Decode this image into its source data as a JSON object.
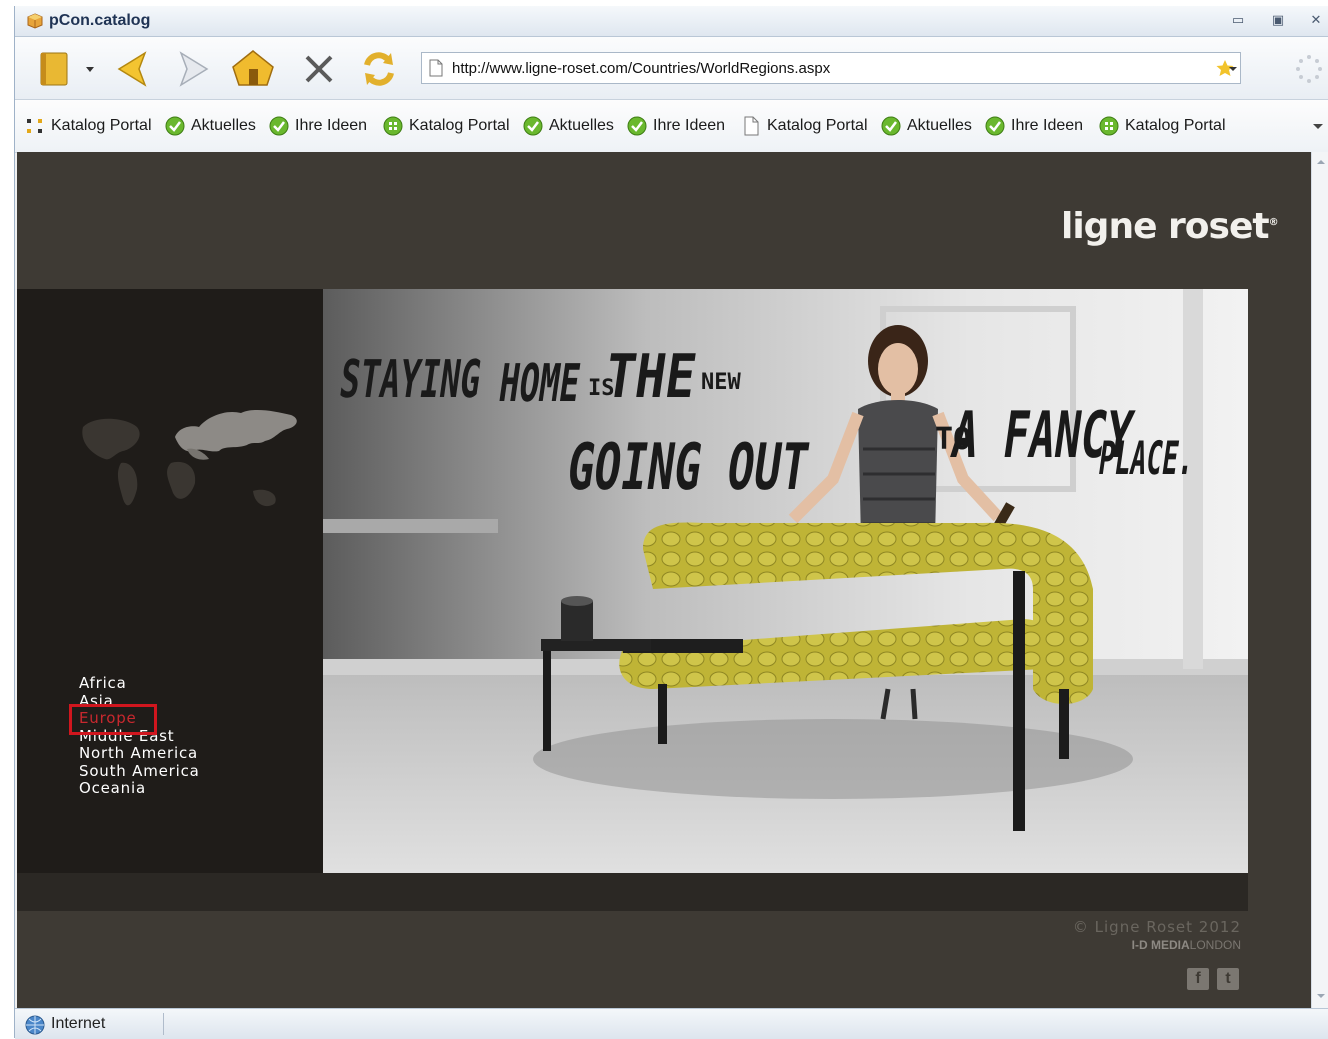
{
  "window": {
    "title": "pCon.catalog",
    "controls": [
      "minimize",
      "restore",
      "close"
    ]
  },
  "toolbar": {
    "url": "http://www.ligne-roset.com/Countries/WorldRegions.aspx",
    "buttons": [
      "catalog-book-icon",
      "dropdown-arrow-icon",
      "back-icon",
      "forward-icon",
      "home-icon",
      "stop-icon",
      "refresh-icon"
    ]
  },
  "favorites": [
    {
      "label": "Katalog Portal",
      "icon": "portal-dots-icon"
    },
    {
      "label": "Aktuelles",
      "icon": "green-check-icon"
    },
    {
      "label": "Ihre Ideen",
      "icon": "green-check-icon"
    },
    {
      "label": "Katalog Portal",
      "icon": "green-grid-icon"
    },
    {
      "label": "Aktuelles",
      "icon": "green-check-icon"
    },
    {
      "label": "Ihre Ideen",
      "icon": "green-check-icon"
    },
    {
      "label": "Katalog Portal",
      "icon": "page-icon"
    },
    {
      "label": "Aktuelles",
      "icon": "green-check-icon"
    },
    {
      "label": "Ihre Ideen",
      "icon": "green-check-icon"
    },
    {
      "label": "Katalog Portal",
      "icon": "green-grid-icon"
    }
  ],
  "page": {
    "brand": "ligne roset",
    "hero_text": {
      "line1a": "STAYING",
      "line1b": "HOME",
      "line1c": "IS",
      "line1d": "THE",
      "line1e": "NEW",
      "line2": "GOING OUT",
      "line3a": "TO",
      "line3b": "A FANCY",
      "line3c": "PLACE."
    },
    "regions": [
      "Africa",
      "Asia",
      "Europe",
      "Middle East",
      "North America",
      "South America",
      "Oceania"
    ],
    "active_region": "Europe",
    "copyright": "© Ligne Roset 2012",
    "credit_bold": "I-D MEDIA",
    "credit_rest": "LONDON",
    "social": [
      "facebook-icon",
      "twitter-icon"
    ]
  },
  "status": {
    "zone": "Internet"
  },
  "colors": {
    "page_bg": "#3e3a34",
    "side_panel": "#1f1c19",
    "active_region": "#c8282e",
    "sofa": "#bfb436"
  }
}
